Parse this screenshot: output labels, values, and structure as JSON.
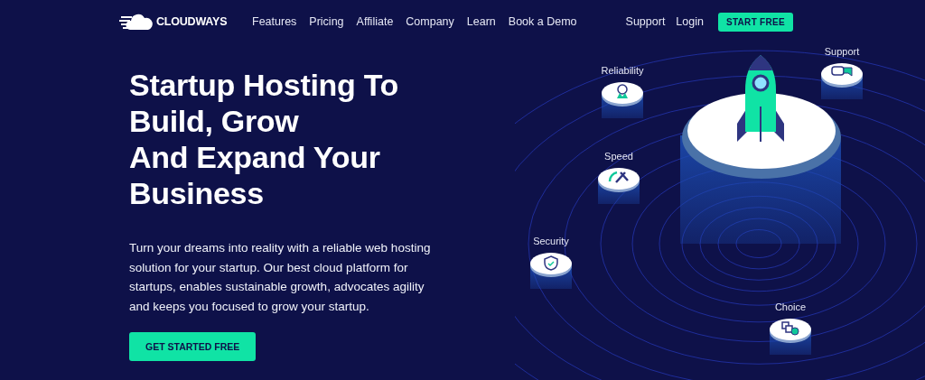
{
  "nav": {
    "logo": "CLOUDWAYS",
    "links": [
      "Features",
      "Pricing",
      "Affiliate",
      "Company",
      "Learn",
      "Book a Demo"
    ],
    "right_links": [
      "Support",
      "Login"
    ],
    "cta": "START FREE"
  },
  "hero": {
    "title_lines": [
      "Startup Hosting To",
      "Build, Grow",
      "And Expand Your",
      "Business"
    ],
    "description": "Turn your dreams into reality with a reliable web hosting solution for your startup. Our best cloud platform for startups, enables sustainable growth, advocates agility and keeps you focused to grow your startup.",
    "button": "GET STARTED FREE"
  },
  "illustration": {
    "features": [
      {
        "label": "Reliability",
        "kind": "award"
      },
      {
        "label": "Support",
        "kind": "chat"
      },
      {
        "label": "Speed",
        "kind": "gauge"
      },
      {
        "label": "Security",
        "kind": "shield"
      },
      {
        "label": "Choice",
        "kind": "shapes"
      }
    ]
  }
}
